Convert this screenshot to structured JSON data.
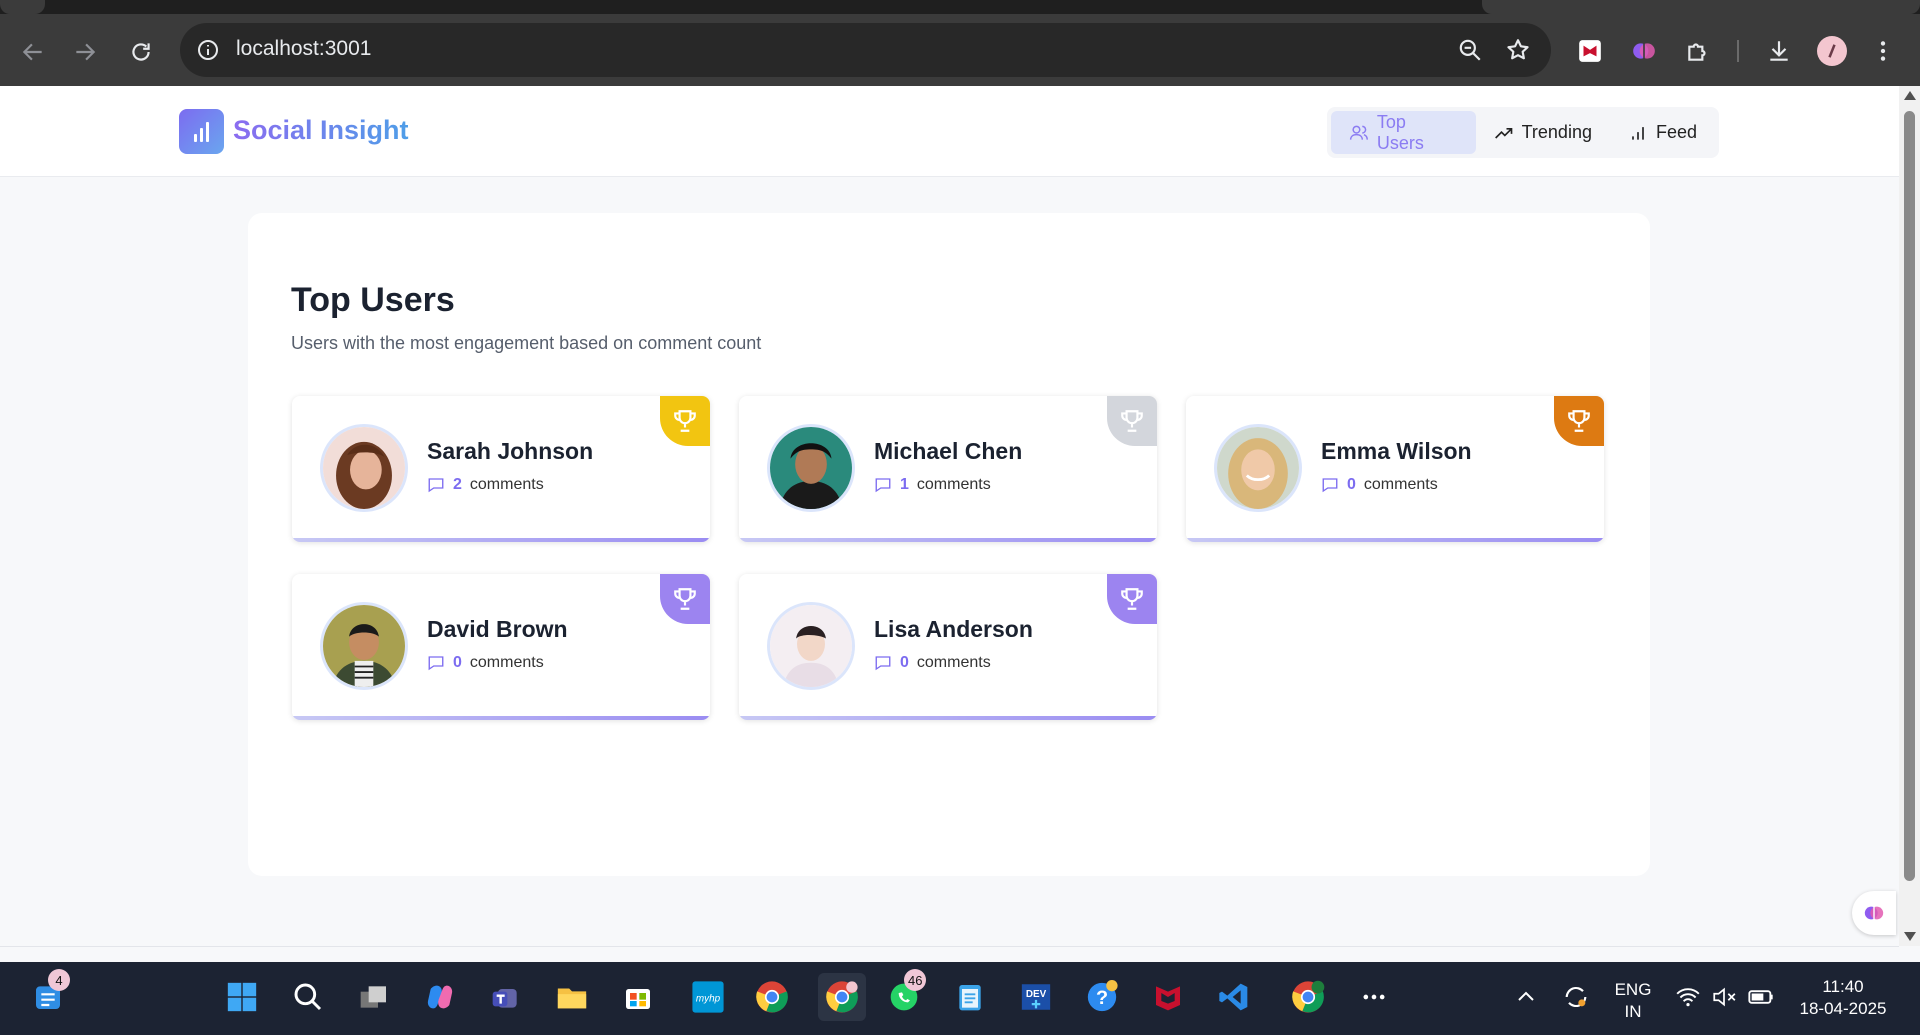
{
  "browser": {
    "url": "localhost:3001"
  },
  "app": {
    "brand": "Social Insight",
    "nav": [
      {
        "label": "Top Users",
        "active": true
      },
      {
        "label": "Trending",
        "active": false
      },
      {
        "label": "Feed",
        "active": false
      }
    ]
  },
  "page": {
    "title": "Top Users",
    "subtitle": "Users with the most engagement based on comment count"
  },
  "users": [
    {
      "name": "Sarah Johnson",
      "count": "2",
      "unit": "comments",
      "trophy_color": "#f2c511"
    },
    {
      "name": "Michael Chen",
      "count": "1",
      "unit": "comments",
      "trophy_color": "#d3d6dc"
    },
    {
      "name": "Emma Wilson",
      "count": "0",
      "unit": "comments",
      "trophy_color": "#dd7a12"
    },
    {
      "name": "David Brown",
      "count": "0",
      "unit": "comments",
      "trophy_color": "#9c84f0"
    },
    {
      "name": "Lisa Anderson",
      "count": "0",
      "unit": "comments",
      "trophy_color": "#9c84f0"
    }
  ],
  "taskbar": {
    "widgets_badge": "4",
    "whatsapp_badge": "46",
    "language_line1": "ENG",
    "language_line2": "IN",
    "time": "11:40",
    "date": "18-04-2025"
  },
  "colors": {
    "accent": "#7c6cf0",
    "active_nav_bg": "#dfe4f9"
  }
}
